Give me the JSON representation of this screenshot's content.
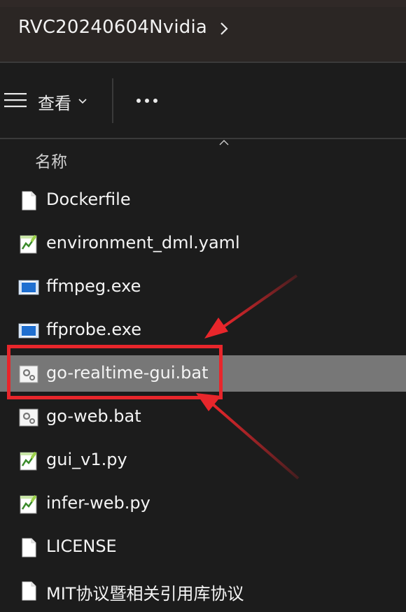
{
  "breadcrumb": {
    "folder": "RVC20240604Nvidia"
  },
  "toolbar": {
    "view_label": "查看"
  },
  "columns": {
    "name": "名称"
  },
  "files": [
    {
      "name": "Dockerfile",
      "icon": "generic-file-icon"
    },
    {
      "name": "environment_dml.yaml",
      "icon": "notepad-plus-file-icon"
    },
    {
      "name": "ffmpeg.exe",
      "icon": "executable-file-icon"
    },
    {
      "name": "ffprobe.exe",
      "icon": "executable-file-icon"
    },
    {
      "name": "go-realtime-gui.bat",
      "icon": "batch-file-icon",
      "selected": true
    },
    {
      "name": "go-web.bat",
      "icon": "batch-file-icon"
    },
    {
      "name": "gui_v1.py",
      "icon": "notepad-plus-file-icon"
    },
    {
      "name": "infer-web.py",
      "icon": "notepad-plus-file-icon"
    },
    {
      "name": "LICENSE",
      "icon": "generic-file-icon"
    },
    {
      "name": "MIT协议暨相关引用库协议",
      "icon": "generic-file-icon"
    }
  ],
  "colors": {
    "background": "#1c1c1c",
    "selection": "#777777",
    "annotation": "#e8262b"
  }
}
